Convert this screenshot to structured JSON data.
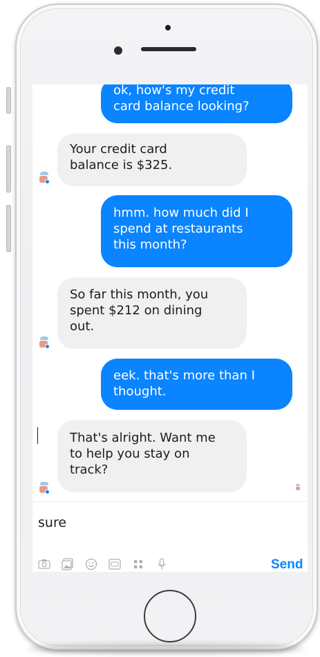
{
  "chat": {
    "messages": [
      {
        "from": "user",
        "lines": "ok, how's my credit\ncard balance looking?"
      },
      {
        "from": "bot",
        "lines": "Your credit card\nbalance is $325."
      },
      {
        "from": "user",
        "lines": "hmm. how much did I\nspend at restaurants\nthis month?"
      },
      {
        "from": "bot",
        "lines": "So far this month, you\nspent $212 on dining\nout."
      },
      {
        "from": "user",
        "lines": "eek. that's more than I\nthought."
      },
      {
        "from": "bot",
        "lines": "That's alright. Want me\nto help you stay on\ntrack?"
      }
    ]
  },
  "composer": {
    "input_value": "sure",
    "send_label": "Send",
    "icons": [
      "camera-icon",
      "gallery-icon",
      "emoji-icon",
      "gif-icon",
      "apps-icon",
      "microphone-icon"
    ]
  },
  "colors": {
    "outgoing_bubble": "#0a84ff",
    "incoming_bubble": "#f0f0f0",
    "send_text": "#0a84ff"
  }
}
